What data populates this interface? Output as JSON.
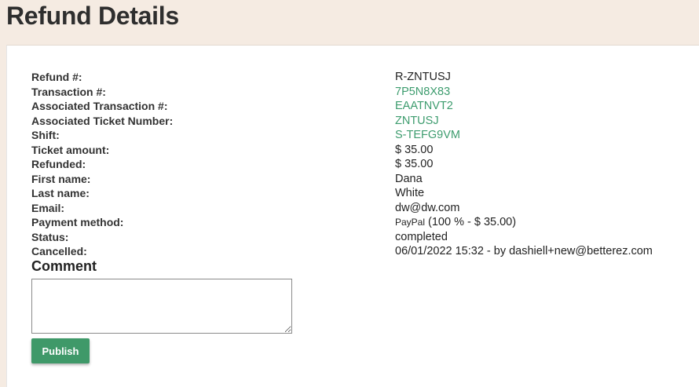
{
  "header": {
    "title": "Refund Details"
  },
  "details": [
    {
      "label": "Refund #:",
      "value": "R-ZNTUSJ",
      "link": false
    },
    {
      "label": "Transaction #:",
      "value": "7P5N8X83",
      "link": true
    },
    {
      "label": "Associated Transaction #:",
      "value": "EAATNVT2",
      "link": true
    },
    {
      "label": "Associated Ticket Number:",
      "value": "ZNTUSJ",
      "link": true
    },
    {
      "label": "Shift:",
      "value": "S-TEFG9VM",
      "link": true
    },
    {
      "label": "Ticket amount:",
      "value": "$ 35.00",
      "link": false
    },
    {
      "label": "Refunded:",
      "value": "$ 35.00",
      "link": false
    },
    {
      "label": "First name:",
      "value": "Dana",
      "link": false
    },
    {
      "label": "Last name:",
      "value": "White",
      "link": false
    },
    {
      "label": "Email:",
      "value": "dw@dw.com",
      "link": false
    },
    {
      "label": "Payment method:",
      "badge": "PayPal",
      "value": "(100 % - $ 35.00)",
      "link": false
    },
    {
      "label": "Status:",
      "value": "completed",
      "link": false
    },
    {
      "label": "Cancelled:",
      "value": "06/01/2022 15:32 - by dashiell+new@betterez.com",
      "link": false
    }
  ],
  "comment": {
    "title": "Comment",
    "value": "",
    "publish_label": "Publish"
  },
  "colors": {
    "link": "#3d9c6e",
    "button": "#3f9969",
    "page_background": "#f5ebe2"
  }
}
